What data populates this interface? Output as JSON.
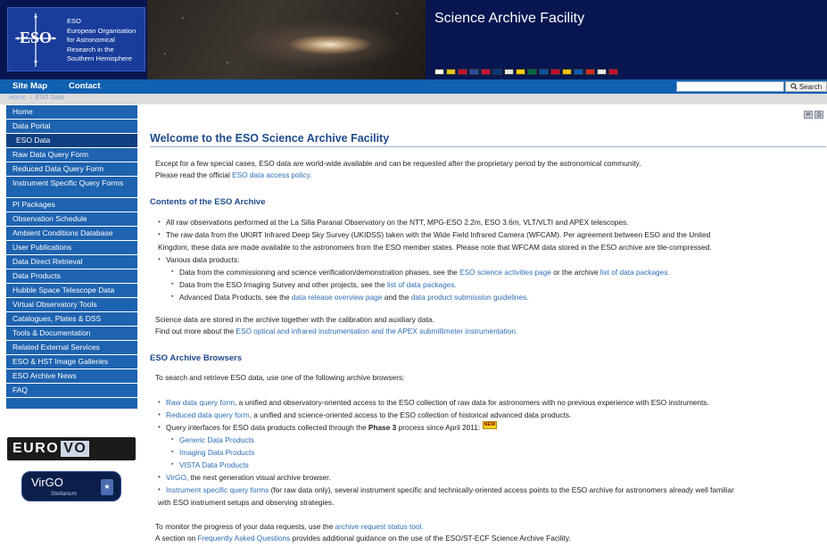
{
  "header": {
    "logo_abbr": "ESO",
    "logo_lines": [
      "ESO",
      "European Organisation",
      "for Astronomical",
      "Research in the",
      "Southern Hemisphere"
    ],
    "site_title": "Science Archive Facility",
    "flags": [
      "#ffffff",
      "#e4c41a",
      "#c8102e",
      "#2a4da0",
      "#d0103a",
      "#003580",
      "#e0e0e0",
      "#ffce00",
      "#006a44",
      "#0055a4",
      "#c60c30",
      "#f1bf00",
      "#005eb8",
      "#d52b1e",
      "#e8e8e8",
      "#c8102e"
    ]
  },
  "nav": {
    "site_map": "Site Map",
    "contact": "Contact",
    "search_placeholder": "",
    "search_label": "Search",
    "search_icon": "magnifier-icon"
  },
  "breadcrumb": {
    "home": "Home",
    "separator": "→",
    "current": "ESO Data"
  },
  "sidebar": {
    "items": [
      "Home",
      "Data Portal",
      "ESO Data",
      "Raw Data Query Form",
      "Reduced Data Query Form",
      "Instrument Specific Query Forms",
      "PI Packages",
      "Observation Schedule",
      "Ambient Conditions Database",
      "User Publications",
      "Data Direct Retrieval",
      "Data Products",
      "Hubble Space Telescope Data",
      "Virtual Observatory Tools",
      "Catalogues, Plates & DSS",
      "Tools & Documentation",
      "Related External Services",
      "ESO & HST Image Galleries",
      "ESO Archive News",
      "FAQ"
    ],
    "eurovo": {
      "euro": "EURO",
      "vo": "VO"
    },
    "virgo": {
      "name": "VirGO",
      "sub": "Stellarium"
    }
  },
  "main": {
    "title": "Welcome to the ESO Science Archive Facility",
    "intro1": "Except for a few special cases, ESO data are world-wide available and can be requested after the proprietary period by the astronomical community.",
    "intro2_pre": "Please read the official ",
    "intro2_link": "ESO data access policy.",
    "contents_heading": "Contents of the ESO Archive",
    "c1": "All raw observations performed at the La Silla Paranal Observatory on the NTT, MPG-ESO 2.2m, ESO 3.6m, VLT/VLTI and APEX telescopes.",
    "c2a": "The raw data from the UKIRT Infrared Deep Sky Survey (UKIDSS) taken with the Wide Field Infrared Camera (WFCAM). Per agreement between ESO and the United",
    "c2b": "Kingdom, these data are made available to the astronomers from the ESO member states. Please note that WFCAM data stored in the ESO archive are tile-compressed.",
    "c3": "Various data products:",
    "c3a_pre": "Data from the commissioning and science verification/demonstration phases, see the ",
    "c3a_link1": "ESO science activities page",
    "c3a_mid": " or the archive ",
    "c3a_link2": "list of data packages.",
    "c3b_pre": "Data from the ESO Imaging Survey and other projects, see the ",
    "c3b_link": "list of data packages.",
    "c3c_pre": "Advanced Data Products, see the ",
    "c3c_link1": "data release overview page",
    "c3c_mid": " and the ",
    "c3c_link2": "data product submission guidelines.",
    "stored1": "Science data are stored in the archive together with the calibration and auxiliary data.",
    "stored2_pre": "Find out more about the ",
    "stored2_link": "ESO optical and infrared instrumentation and the APEX submillimeter instrumentation.",
    "browsers_heading": "ESO Archive Browsers",
    "browsers_intro": "To search and retrieve ESO data, use one of the following archive browsers:",
    "b1_link": "Raw data query form",
    "b1_rest": ", a unified and observatory-oriented access to the ESO collection of raw data for astronomers with no previous experience with ESO instruments.",
    "b2_link": "Reduced data query form",
    "b2_rest": ", a unified and science-oriented access to the ESO collection of historical advanced data products.",
    "b3_pre": "Query interfaces for ESO data products collected through the ",
    "b3_bold": "Phase 3",
    "b3_post": " process since April 2011: ",
    "new_badge": "NEW",
    "b3_subs": [
      "Generic Data Products",
      "Imaging Data Products",
      "VISTA Data Products"
    ],
    "b4_link": "VirGO",
    "b4_rest": ", the next generation visual archive browser.",
    "b5_link": "Instrument specific query forms",
    "b5_rest": " (for raw data only), several instrument specific and technically-oriented access points to the ESO archive for astronomers already well familiar",
    "b5_cont": "with ESO instrument setups and observing strategies.",
    "monitor_pre": "To monitor the progress of your data requests, use the ",
    "monitor_link": "archive request status tool.",
    "faq_pre": "A section on ",
    "faq_link": "Frequently Asked Questions",
    "faq_post": " provides additional guidance on the use of the ESO/ST-ECF Science Archive Facility."
  }
}
